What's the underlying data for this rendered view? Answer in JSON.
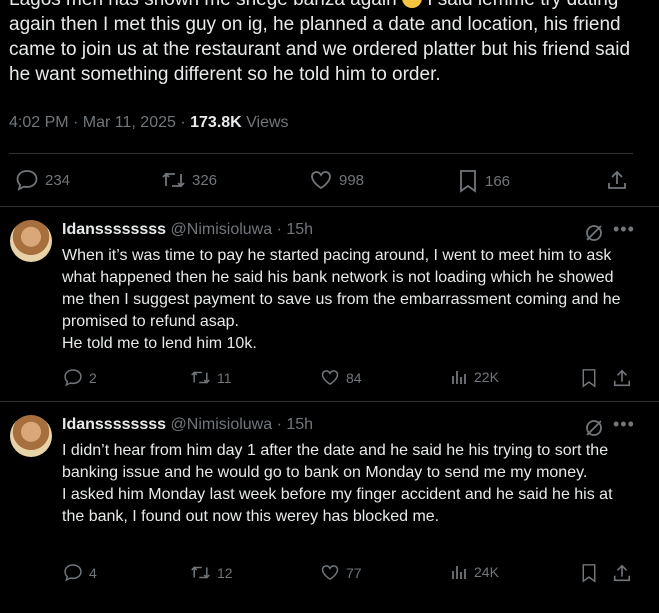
{
  "tweet": {
    "text_lines": [
      "Lagos men has shown me shege banza again",
      " I said lemme try dating again then I met this guy on ig, he planned a date and location, his friend came to join us at the restaurant and we ordered platter but his friend said he want something different so he told him to order."
    ],
    "time": "4:02 PM · Mar 11, 2025 · ",
    "views_count": "173.8K",
    "views_label": " Views",
    "replies": "234",
    "reposts": "326",
    "likes": "998",
    "bookmarks": "166"
  },
  "replies": [
    {
      "name": "Idanssssssss",
      "handle": "@Nimisioluwa",
      "age": " · 15h",
      "paragraphs": [
        "When it’s was time to pay he started pacing around, I went to meet him to ask what happened then he said his bank network is not loading which he showed me then I suggest payment to save us from the embarrassment coming and he promised to refund asap.",
        "He told me to lend him 10k."
      ],
      "replies": "2",
      "reposts": "11",
      "likes": "84",
      "views": "22K"
    },
    {
      "name": "Idanssssssss",
      "handle": "@Nimisioluwa",
      "age": " · 15h",
      "paragraphs": [
        "I didn’t hear from him day 1 after the date and he said he his trying to sort the banking issue and he would go to bank on Monday to send me my money.",
        "I asked him Monday last week before my finger accident and he said he his at the bank, I found out now this werey has blocked me."
      ],
      "replies": "4",
      "reposts": "12",
      "likes": "77",
      "views": "24K"
    }
  ],
  "icons": {
    "more": "more-icon",
    "grok": "grok-icon",
    "emoji": "rolling-laughing-emoji"
  }
}
